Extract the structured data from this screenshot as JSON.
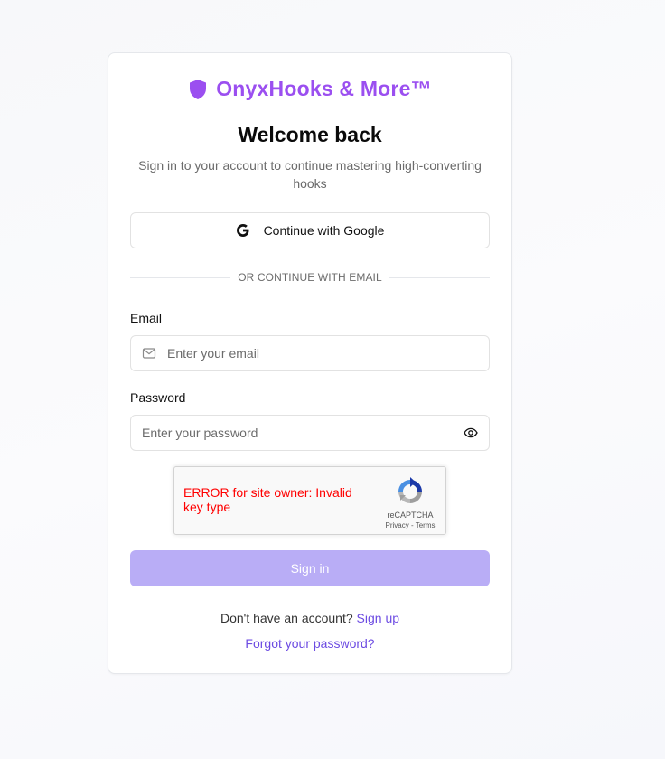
{
  "brand": {
    "name": "OnyxHooks & More™",
    "color": "#9b4ff0",
    "icon": "shield-icon"
  },
  "header": {
    "title": "Welcome back",
    "subtitle": "Sign in to your account to continue mastering high-converting hooks"
  },
  "google": {
    "label": "Continue with Google",
    "icon": "google-icon"
  },
  "divider": {
    "text": "OR CONTINUE WITH EMAIL"
  },
  "form": {
    "email": {
      "label": "Email",
      "placeholder": "Enter your email",
      "value": "",
      "icon": "mail-icon"
    },
    "password": {
      "label": "Password",
      "placeholder": "Enter your password",
      "value": "",
      "icon": "eye-icon"
    }
  },
  "recaptcha": {
    "error": "ERROR for site owner: Invalid key type",
    "brand": "reCAPTCHA",
    "links": "Privacy - Terms"
  },
  "submit": {
    "label": "Sign in",
    "color": "#b9adf6"
  },
  "footer": {
    "signup_prompt": "Don't have an account?",
    "signup_link": "Sign up",
    "forgot_link": "Forgot your password?",
    "link_color": "#6c4be2"
  }
}
